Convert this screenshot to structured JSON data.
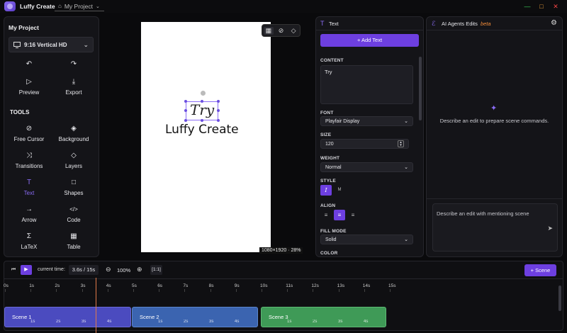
{
  "app": {
    "name": "Luffy Create",
    "project_tab": "My Project"
  },
  "window": {
    "minimize": "—",
    "maximize": "□",
    "close": "✕"
  },
  "left_panel": {
    "title": "My Project",
    "format": "9:16 Vertical HD",
    "actions": [
      {
        "label": "",
        "icon": "undo-icon"
      },
      {
        "label": "",
        "icon": "redo-icon"
      },
      {
        "label": "Preview",
        "icon": "play-icon"
      },
      {
        "label": "Export",
        "icon": "download-icon"
      }
    ],
    "tools_title": "TOOLS",
    "tools": [
      {
        "label": "Free Cursor",
        "icon": "cursor-off-icon"
      },
      {
        "label": "Background",
        "icon": "paint-bucket-icon"
      },
      {
        "label": "Transitions",
        "icon": "shuffle-icon"
      },
      {
        "label": "Layers",
        "icon": "layers-icon"
      },
      {
        "label": "Text",
        "icon": "text-icon",
        "active": true
      },
      {
        "label": "Shapes",
        "icon": "square-icon"
      },
      {
        "label": "Arrow",
        "icon": "arrow-icon"
      },
      {
        "label": "Code",
        "icon": "code-icon"
      },
      {
        "label": "LaTeX",
        "icon": "sigma-icon"
      },
      {
        "label": "Table",
        "icon": "table-icon"
      }
    ]
  },
  "canvas": {
    "text_try": "Try",
    "text_main": "Luffy Create",
    "resolution": "1080×1920 · 28%"
  },
  "text_panel": {
    "header": "Text",
    "add_button": "+ Add Text",
    "content_label": "CONTENT",
    "content_value": "Try",
    "font_label": "FONT",
    "font_value": "Playfair Display",
    "size_label": "SIZE",
    "size_value": "120",
    "weight_label": "WEIGHT",
    "weight_value": "Normal",
    "style_label": "STYLE",
    "style_italic": "I",
    "style_mono": "M",
    "align_label": "ALIGN",
    "fill_mode_label": "FILL MODE",
    "fill_mode_value": "Solid",
    "color_label": "COLOR"
  },
  "ai_panel": {
    "title": "AI Agents Edits",
    "beta": "beta",
    "empty_message": "Describe an edit to prepare scene commands.",
    "input_placeholder": "Describe an edit with mentioning scene"
  },
  "timeline": {
    "current_time_label": "current time:",
    "current_time_value": "3.6s / 15s",
    "zoom": "100%",
    "fit_label": "[1:1]",
    "add_scene": "+ Scene",
    "ticks": [
      "0s",
      "1s",
      "2s",
      "3s",
      "4s",
      "5s",
      "6s",
      "7s",
      "8s",
      "9s",
      "10s",
      "11s",
      "12s",
      "13s",
      "14s",
      "15s"
    ],
    "scenes": [
      {
        "label": "Scene 1",
        "ticks": [
          "1s",
          "2s",
          "3s",
          "4s"
        ],
        "color": "#4b4bbf"
      },
      {
        "label": "Scene 2",
        "ticks": [
          "1s",
          "2s",
          "3s",
          "4s"
        ],
        "color": "#3b64b0"
      },
      {
        "label": "Scene 3",
        "ticks": [
          "1s",
          "2s",
          "3s",
          "4s"
        ],
        "color": "#3f9a57"
      }
    ]
  },
  "colors": {
    "accent": "#6d3fe0",
    "playhead": "#e07a4a"
  }
}
